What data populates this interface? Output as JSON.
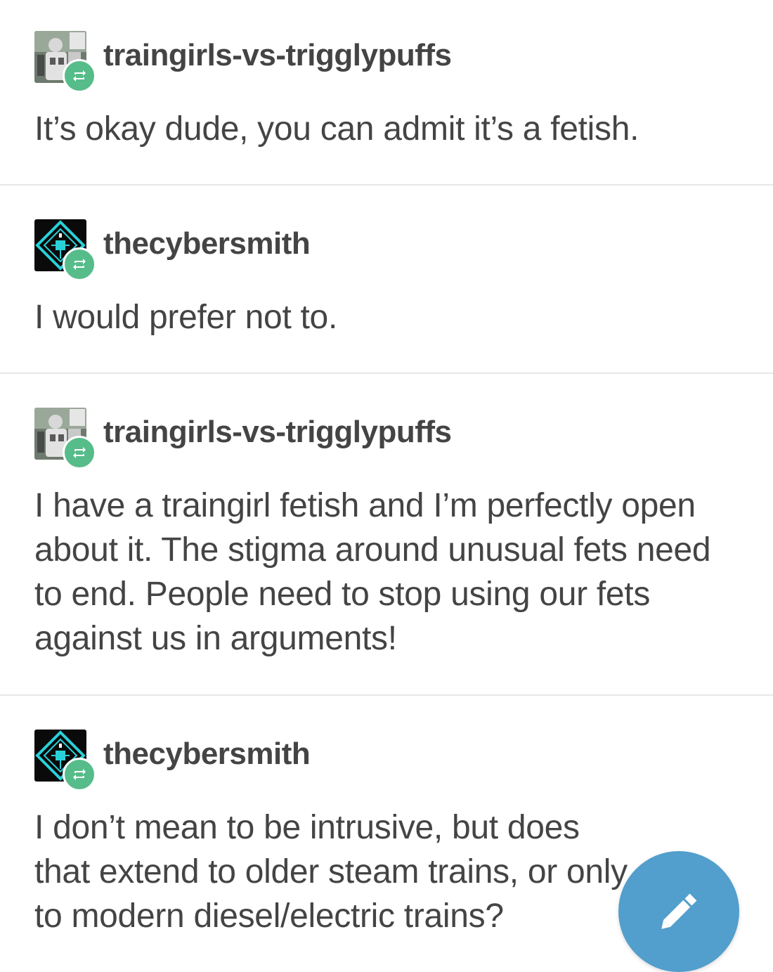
{
  "posts": [
    {
      "username": "traingirls-vs-trigglypuffs",
      "avatar_icon": "robot-figure-avatar",
      "text": "It’s okay dude, you can admit it’s a fetish."
    },
    {
      "username": "thecybersmith",
      "avatar_icon": "cyan-diamond-circuit-avatar",
      "text": "I would prefer not to."
    },
    {
      "username": "traingirls-vs-trigglypuffs",
      "avatar_icon": "robot-figure-avatar",
      "text": "I have a traingirl fetish and I’m perfectly open about it. The stigma around unusual fets need to end. People need to stop using our fets against us in arguments!"
    },
    {
      "username": "thecybersmith",
      "avatar_icon": "cyan-diamond-circuit-avatar",
      "text": "I don’t mean to be intrusive, but does that extend to older steam trains, or only to modern diesel/electric trains?"
    }
  ],
  "colors": {
    "text": "#444444",
    "reblog_badge": "#56bc8a",
    "fab": "#529ecc",
    "divider": "#e8e8e8"
  },
  "fab": {
    "icon": "pencil-icon"
  }
}
